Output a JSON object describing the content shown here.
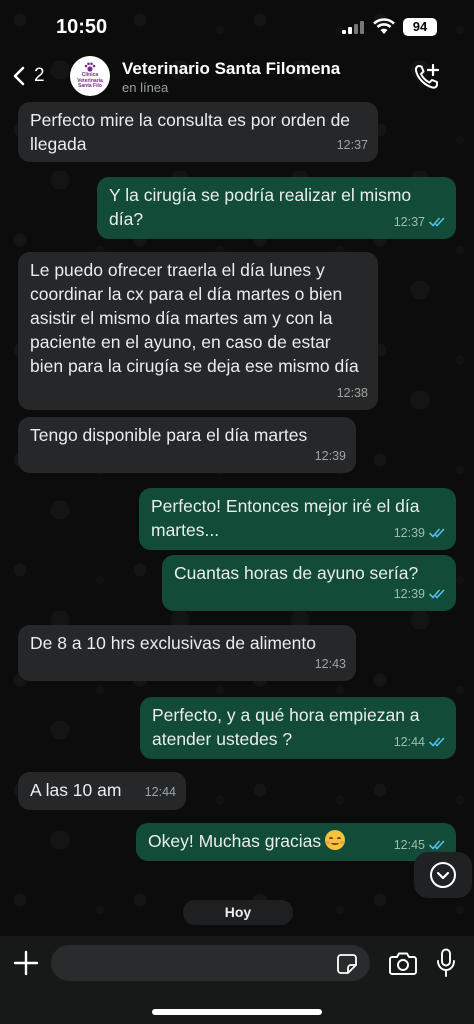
{
  "status_bar": {
    "time": "10:50",
    "battery": "94"
  },
  "header": {
    "back_count": "2",
    "contact_name": "Veterinario Santa Filomena",
    "contact_status": "en línea",
    "avatar_text": [
      "Clínica",
      "Veterinaria",
      "Santa Filo"
    ]
  },
  "messages": [
    {
      "direction": "in",
      "text": "Perfecto mire la consulta es  por orden de llegada",
      "time": "12:37"
    },
    {
      "direction": "out",
      "text": "Y la cirugía se podría realizar el mismo día?",
      "time": "12:37",
      "status": "read"
    },
    {
      "direction": "in",
      "text": "Le puedo ofrecer traerla el día lunes y coordinar la cx para el día martes o bien asistir el mismo día martes am y con la paciente en el ayuno, en caso de estar bien para la cirugía se deja ese mismo día",
      "time": "12:38"
    },
    {
      "direction": "in",
      "text": "Tengo disponible para el día martes",
      "time": "12:39"
    },
    {
      "direction": "out",
      "text": "Perfecto! Entonces mejor iré el día martes...",
      "time": "12:39",
      "status": "read"
    },
    {
      "direction": "out",
      "text": "Cuantas horas de ayuno sería?",
      "time": "12:39",
      "status": "read"
    },
    {
      "direction": "in",
      "text": "De 8 a 10 hrs exclusivas de alimento",
      "time": "12:43"
    },
    {
      "direction": "out",
      "text": "Perfecto, y a qué hora empiezan a atender ustedes ?",
      "time": "12:44",
      "status": "read"
    },
    {
      "direction": "in",
      "text": "A las 10 am",
      "time": "12:44"
    },
    {
      "direction": "out",
      "text": "Okey! Muchas gracias",
      "time": "12:45",
      "status": "read",
      "emoji": "smiling-face-icon"
    }
  ],
  "date_separator": "Hoy",
  "composer": {
    "value": "",
    "placeholder": ""
  },
  "colors": {
    "incoming_bubble": "#262728",
    "outgoing_bubble": "#124b38",
    "read_ticks": "#53bdeb"
  }
}
